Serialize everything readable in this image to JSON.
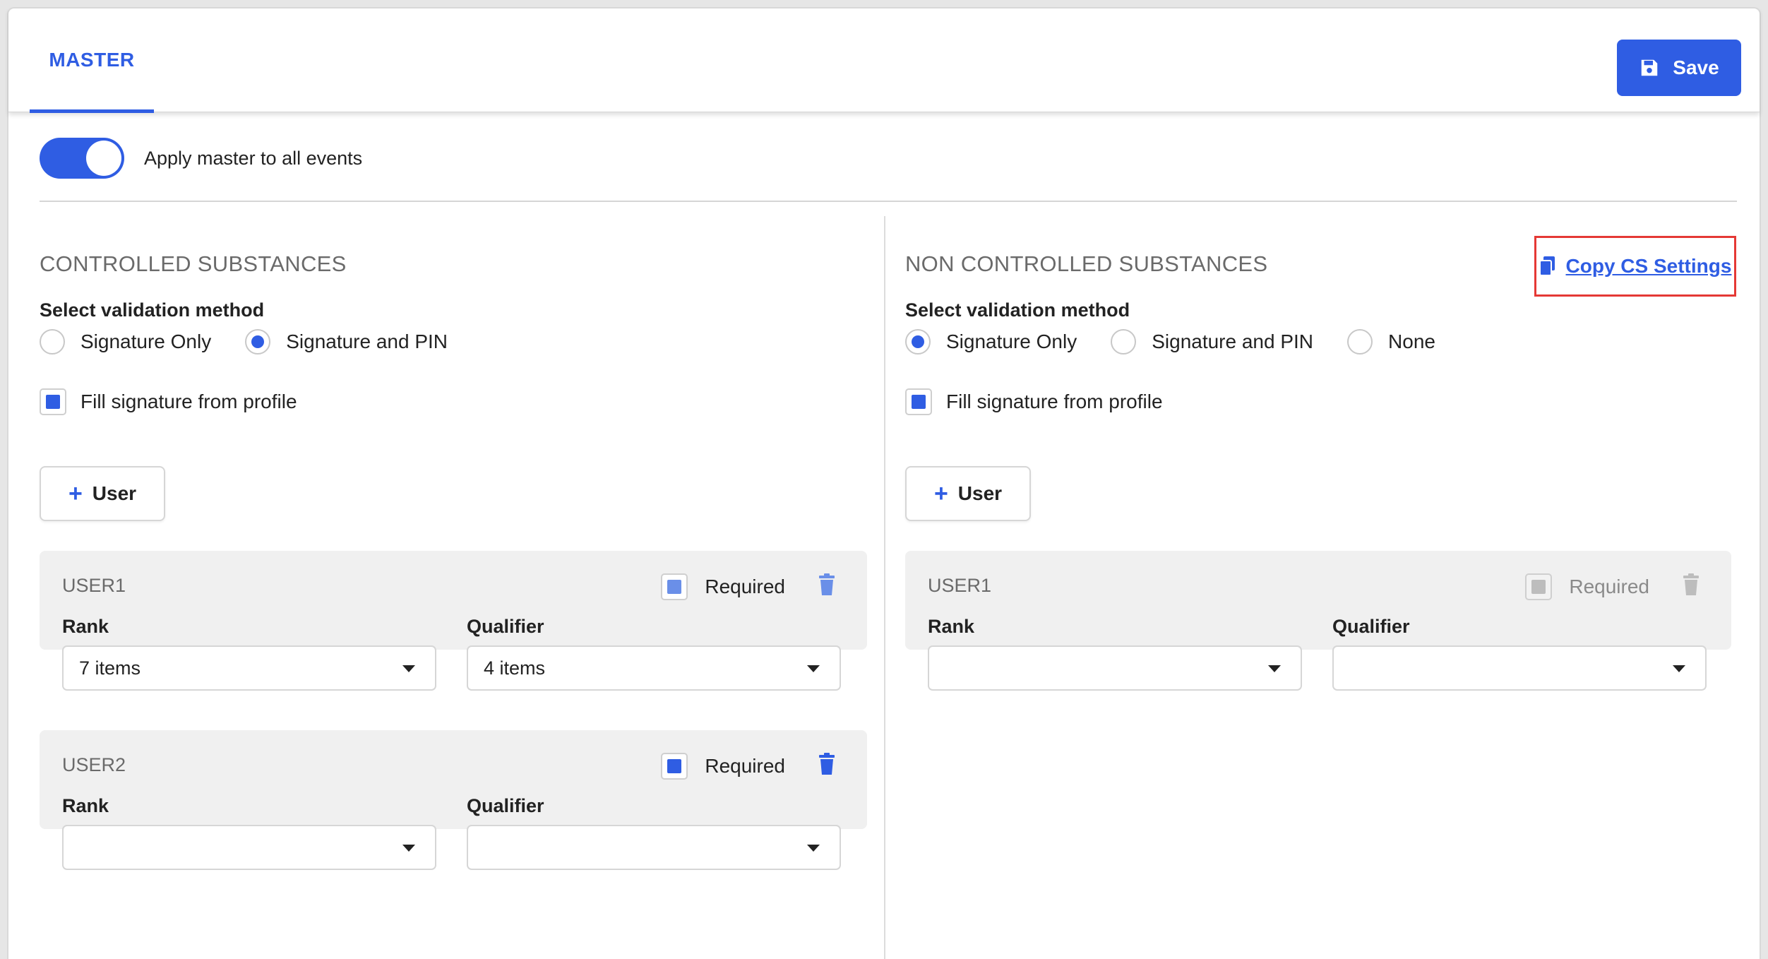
{
  "header": {
    "tab_label": "MASTER",
    "save_label": "Save"
  },
  "toggle": {
    "label": "Apply master to all events",
    "on": true
  },
  "controlled": {
    "title": "CONTROLLED SUBSTANCES",
    "validation_label": "Select validation method",
    "options": [
      "Signature Only",
      "Signature and PIN"
    ],
    "selected": "Signature and PIN",
    "fill_signature_label": "Fill signature from profile",
    "add_user_label": "User",
    "users": [
      {
        "name": "USER1",
        "required_label": "Required",
        "rank_label": "Rank",
        "rank_value": "7 items",
        "qualifier_label": "Qualifier",
        "qualifier_value": "4 items"
      },
      {
        "name": "USER2",
        "required_label": "Required",
        "rank_label": "Rank",
        "rank_value": "",
        "qualifier_label": "Qualifier",
        "qualifier_value": ""
      }
    ]
  },
  "non_controlled": {
    "title": "NON CONTROLLED SUBSTANCES",
    "copy_link": "Copy CS Settings",
    "validation_label": "Select validation method",
    "options": [
      "Signature Only",
      "Signature and PIN",
      "None"
    ],
    "selected": "Signature Only",
    "fill_signature_label": "Fill signature from profile",
    "add_user_label": "User",
    "users": [
      {
        "name": "USER1",
        "required_label": "Required",
        "rank_label": "Rank",
        "rank_value": "",
        "qualifier_label": "Qualifier",
        "qualifier_value": ""
      }
    ]
  },
  "colors": {
    "accent": "#2f5de3",
    "highlight_border": "#e53935"
  }
}
